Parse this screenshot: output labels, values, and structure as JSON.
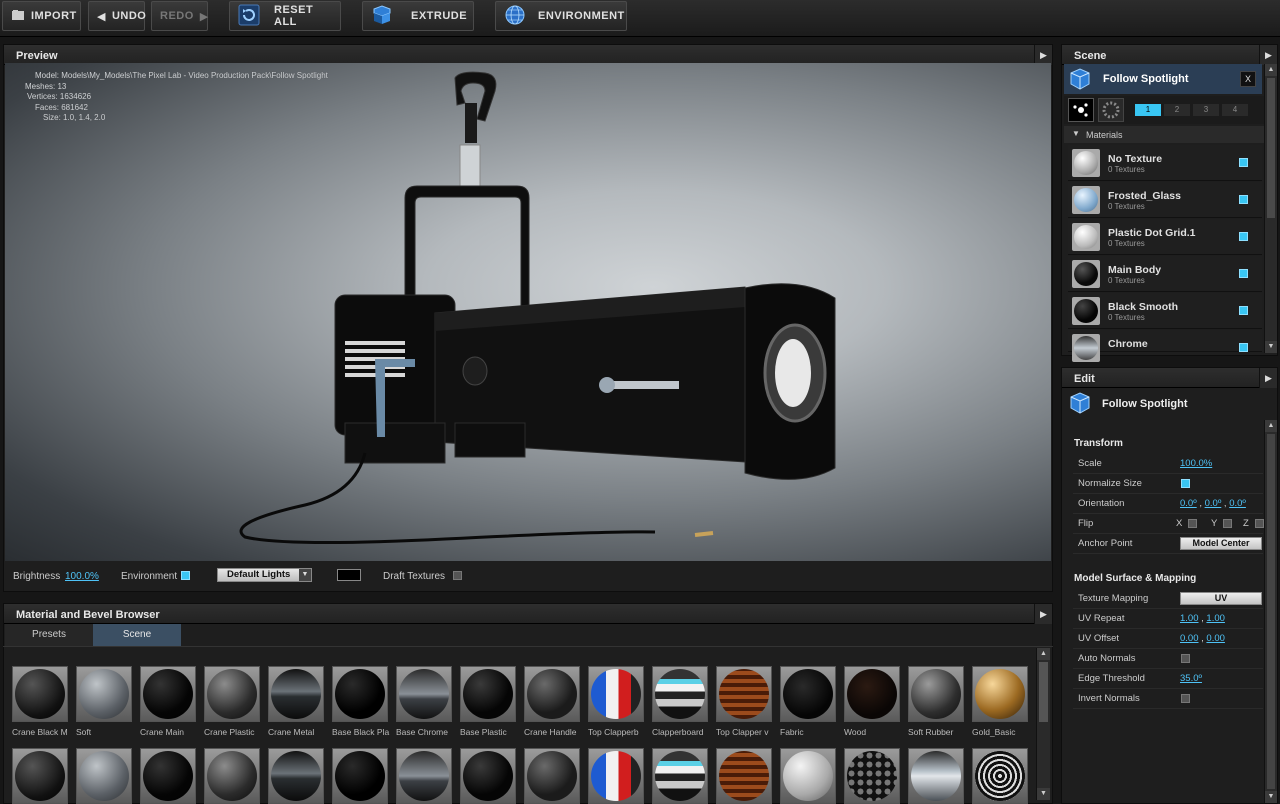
{
  "toolbar": {
    "import": "IMPORT",
    "undo": "UNDO",
    "redo": "REDO",
    "reset_all": "RESET ALL",
    "extrude": "EXTRUDE",
    "environment": "ENVIRONMENT"
  },
  "preview": {
    "title": "Preview",
    "info": {
      "model": "Model: Models\\My_Models\\The Pixel Lab - Video Production Pack\\Follow Spotlight",
      "meshes": "Meshes: 13",
      "vertices": "Vertices: 1634626",
      "faces": "Faces: 681642",
      "size": "Size: 1.0, 1.4, 2.0"
    },
    "brightness_label": "Brightness",
    "brightness_value": "100.0%",
    "environment_label": "Environment",
    "lights_select": "Default Lights",
    "draft_textures_label": "Draft Textures"
  },
  "browser": {
    "title": "Material and Bevel Browser",
    "tabs": [
      "Presets",
      "Scene"
    ],
    "row1": [
      "Crane Black M",
      "Soft",
      "Crane Main",
      "Crane Plastic",
      "Crane Metal",
      "Base Black Pla",
      "Base Chrome",
      "Base Plastic",
      "Crane Handle",
      "Top Clapperb",
      "Clapperboard",
      "Top Clapper v",
      "Fabric",
      "Wood",
      "Soft Rubber",
      "Gold_Basic"
    ]
  },
  "scene": {
    "title": "Scene",
    "object_name": "Follow Spotlight",
    "close_label": "X",
    "pages": [
      "1",
      "2",
      "3",
      "4"
    ],
    "materials_header": "Materials",
    "materials": [
      {
        "name": "No Texture",
        "sub": "0 Textures"
      },
      {
        "name": "Frosted_Glass",
        "sub": "0 Textures"
      },
      {
        "name": "Plastic Dot Grid.1",
        "sub": "0 Textures"
      },
      {
        "name": "Main Body",
        "sub": "0 Textures"
      },
      {
        "name": "Black Smooth",
        "sub": "0 Textures"
      },
      {
        "name": "Chrome",
        "sub": ""
      }
    ]
  },
  "edit": {
    "title": "Edit",
    "object_name": "Follow Spotlight",
    "transform_header": "Transform",
    "scale_label": "Scale",
    "scale_value": "100.0%",
    "normalize_label": "Normalize Size",
    "orientation_label": "Orientation",
    "orientation_x": "0.0º",
    "orientation_y": "0.0º",
    "orientation_z": "0.0º",
    "flip_label": "Flip",
    "flip_x": "X",
    "flip_y": "Y",
    "flip_z": "Z",
    "anchor_label": "Anchor Point",
    "anchor_value": "Model Center",
    "surface_header": "Model Surface & Mapping",
    "texture_mapping_label": "Texture Mapping",
    "texture_mapping_value": "UV",
    "uv_repeat_label": "UV Repeat",
    "uv_repeat_u": "1.00",
    "uv_repeat_v": "1.00",
    "uv_offset_label": "UV Offset",
    "uv_offset_u": "0.00",
    "uv_offset_v": "0.00",
    "auto_normals_label": "Auto Normals",
    "edge_threshold_label": "Edge Threshold",
    "edge_threshold_value": "35.0º",
    "invert_normals_label": "Invert Normals"
  },
  "colors": {
    "accent": "#39c6f3",
    "link": "#4fc3f7",
    "tab_active": "#3b4f63"
  }
}
